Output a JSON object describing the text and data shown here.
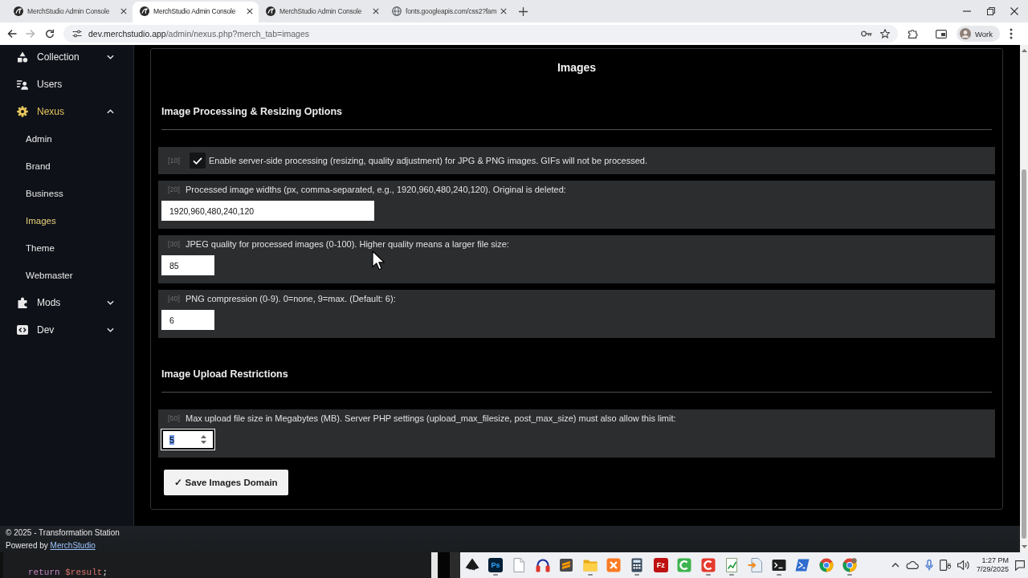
{
  "browser": {
    "tabs": [
      {
        "title": "MerchStudio Admin Console",
        "selected": false
      },
      {
        "title": "MerchStudio Admin Console",
        "selected": true
      },
      {
        "title": "MerchStudio Admin Console",
        "selected": false
      },
      {
        "title": "fonts.googleapis.com/css2?fam",
        "selected": false
      }
    ],
    "address": {
      "host": "dev.merchstudio.app",
      "path": "/admin/nexus.php?merch_tab=images"
    },
    "profile": "Work"
  },
  "sidebar": {
    "items": [
      {
        "label": "Collection",
        "selected": false,
        "expanded": false
      },
      {
        "label": "Users",
        "selected": false
      },
      {
        "label": "Nexus",
        "selected": true,
        "expanded": true,
        "children": [
          {
            "label": "Admin",
            "selected": false
          },
          {
            "label": "Brand",
            "selected": false
          },
          {
            "label": "Business",
            "selected": false
          },
          {
            "label": "Images",
            "selected": true
          },
          {
            "label": "Theme",
            "selected": false
          },
          {
            "label": "Webmaster",
            "selected": false
          }
        ]
      },
      {
        "label": "Mods",
        "selected": false,
        "expanded": false
      },
      {
        "label": "Dev",
        "selected": false,
        "expanded": false
      }
    ]
  },
  "panel": {
    "title": "Images",
    "sections": [
      {
        "title": "Image Processing & Resizing Options",
        "settings": [
          {
            "kind": "checkbox",
            "number": "[10]",
            "label": "Enable server-side processing (resizing, quality adjustment) for JPG & PNG images. GIFs will not be processed.",
            "checked": true,
            "focused": false
          },
          {
            "kind": "text",
            "number": "[20]",
            "label": "Processed image widths (px, comma-separated, e.g., 1920,960,480,240,120). Original is deleted:",
            "value": "1920,960,480,240,120",
            "focused": false
          },
          {
            "kind": "number",
            "number": "[30]",
            "label": "JPEG quality for processed images (0-100). Higher quality means a larger file size:",
            "value": "85",
            "focused": false
          },
          {
            "kind": "number",
            "number": "[40]",
            "label": "PNG compression (0-9). 0=none, 9=max. (Default: 6):",
            "value": "6",
            "focused": false
          }
        ]
      },
      {
        "title": "Image Upload Restrictions",
        "settings": [
          {
            "kind": "number",
            "number": "[50]",
            "label": "Max upload file size in Megabytes (MB). Server PHP settings (upload_max_filesize, post_max_size) must also allow this limit:",
            "value": "5",
            "focused": true
          }
        ]
      }
    ],
    "save_button": "✓ Save Images Domain"
  },
  "footer": {
    "copyright": "© 2025 - Transformation Station",
    "powered_by": "Powered by",
    "link": "MerchStudio"
  },
  "editor": {
    "tokens": [
      {
        "text": "return",
        "kind": "keyword"
      },
      {
        "text": "$result",
        "kind": "variable"
      },
      {
        "text": ";",
        "kind": "punctuation"
      }
    ]
  },
  "taskbar": {
    "apps": [
      {
        "kind": "icon",
        "running": false
      },
      {
        "kind": "lettered",
        "label": "Ps",
        "running": true
      },
      {
        "kind": "icon",
        "running": false
      },
      {
        "kind": "icon",
        "running": false
      },
      {
        "kind": "icon",
        "running": false
      },
      {
        "kind": "icon",
        "running": true
      },
      {
        "kind": "icon",
        "running": false
      },
      {
        "kind": "icon",
        "running": true
      },
      {
        "kind": "lettered",
        "label": "Fz",
        "running": false
      },
      {
        "kind": "icon",
        "running": false
      },
      {
        "kind": "icon",
        "running": true
      },
      {
        "kind": "icon",
        "running": true
      },
      {
        "kind": "icon",
        "running": false
      },
      {
        "kind": "icon",
        "running": true
      },
      {
        "kind": "icon",
        "running": false
      },
      {
        "kind": "icon",
        "running": false
      },
      {
        "kind": "icon",
        "running": true
      }
    ],
    "time": "1:27 PM",
    "date": "7/29/2025"
  }
}
